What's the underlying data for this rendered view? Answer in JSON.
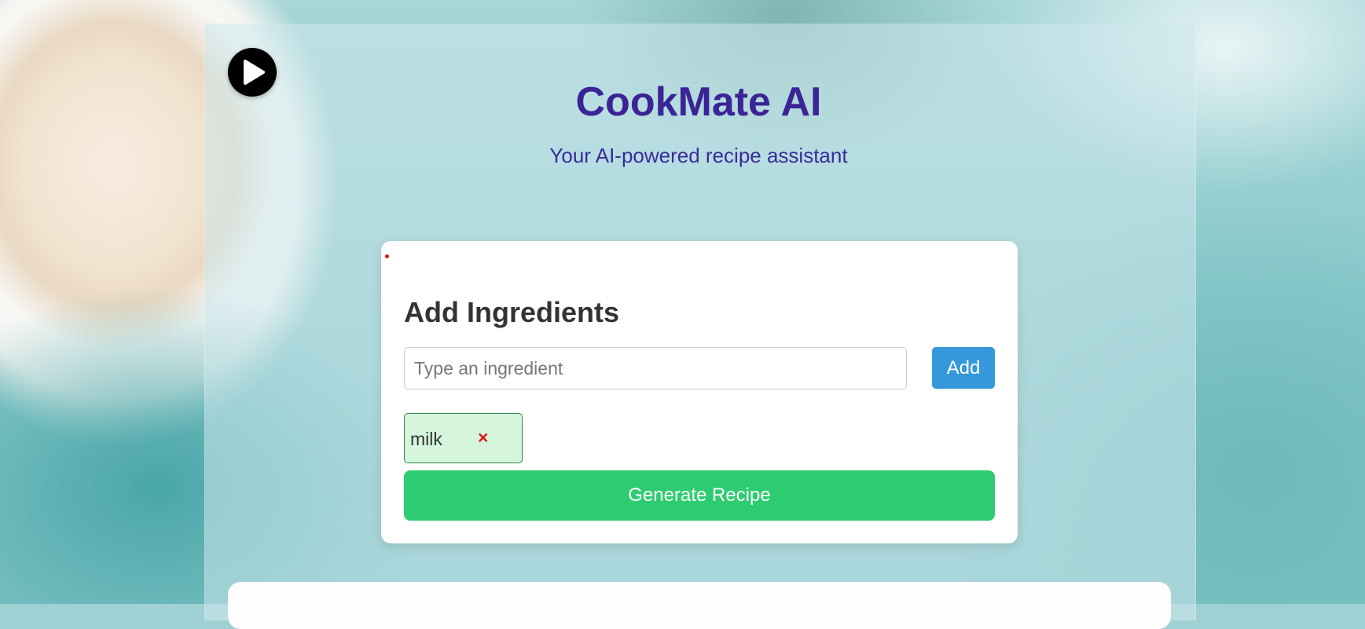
{
  "app": {
    "title": "CookMate AI",
    "subtitle": "Your AI-powered recipe assistant"
  },
  "player": {
    "icon": "play-icon"
  },
  "ingredients_card": {
    "heading": "Add Ingredients",
    "input_placeholder": "Type an ingredient",
    "input_value": "",
    "add_label": "Add",
    "tags": [
      {
        "label": "milk",
        "remove_symbol": "×"
      }
    ],
    "generate_label": "Generate Recipe"
  },
  "colors": {
    "title": "#3b2496",
    "add_button": "#3498db",
    "generate_button": "#2ecc71",
    "tag_background": "#d5f5dc",
    "tag_remove": "#e01818"
  }
}
